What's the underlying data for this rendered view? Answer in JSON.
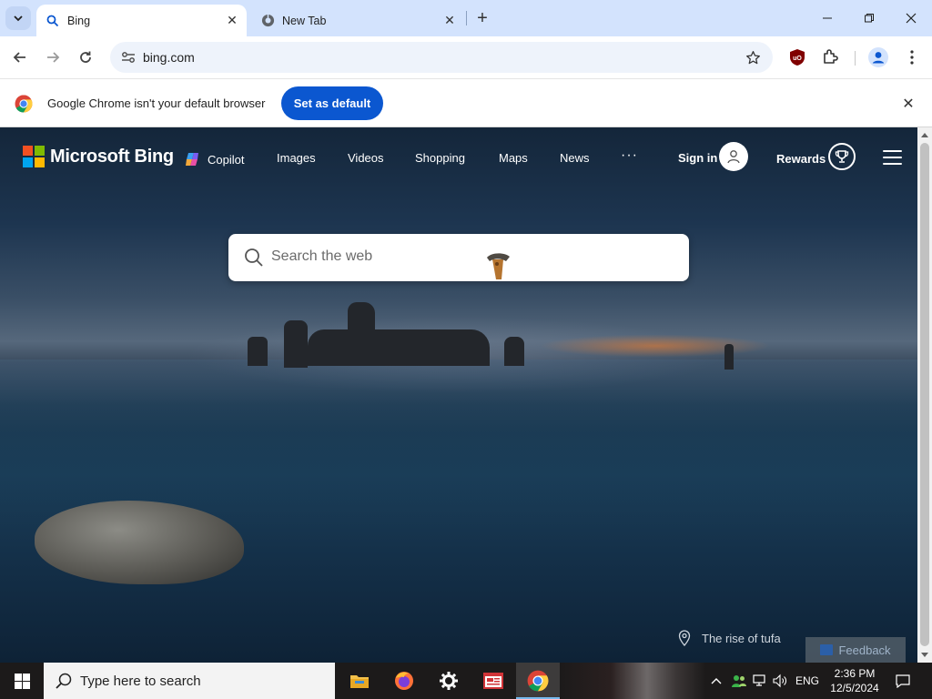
{
  "browser": {
    "tabs": [
      {
        "title": "Bing",
        "active": true
      },
      {
        "title": "New Tab",
        "active": false
      }
    ],
    "url": "bing.com",
    "infobar": {
      "message": "Google Chrome isn't your default browser",
      "button": "Set as default"
    }
  },
  "bing": {
    "logo_text": "Microsoft Bing",
    "nav": [
      "Copilot",
      "Images",
      "Videos",
      "Shopping",
      "Maps",
      "News"
    ],
    "more": "···",
    "signin": "Sign in",
    "rewards": "Rewards",
    "search_placeholder": "Search the web",
    "image_caption": "The rise of tufa",
    "feedback": "Feedback"
  },
  "taskbar": {
    "search_placeholder": "Type here to search",
    "language": "ENG",
    "time": "2:36 PM",
    "date": "12/5/2024",
    "apps": [
      "file-explorer",
      "firefox",
      "settings",
      "news-app",
      "chrome"
    ]
  },
  "colors": {
    "tabstrip": "#d3e3fd",
    "accent_button": "#0b57d0",
    "taskbar": "#1c1a1a"
  }
}
